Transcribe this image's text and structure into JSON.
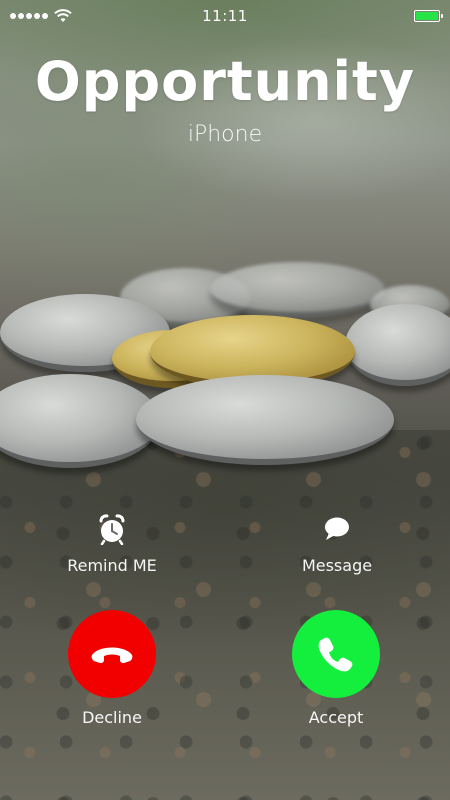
{
  "status_bar": {
    "time": "11:11",
    "signal_icon": "signal-dots-icon",
    "wifi_icon": "wifi-icon",
    "battery_icon": "battery-icon",
    "battery_color": "#27e34a"
  },
  "call": {
    "caller_name": "Opportunity",
    "caller_subtitle": "iPhone"
  },
  "actions": {
    "remind": {
      "label": "Remind ME",
      "icon": "alarm-clock-icon"
    },
    "message": {
      "label": "Message",
      "icon": "speech-bubble-icon"
    },
    "decline": {
      "label": "Decline",
      "icon": "phone-hangup-icon",
      "color": "#f20000"
    },
    "accept": {
      "label": "Accept",
      "icon": "phone-icon",
      "color": "#14ef3e"
    }
  }
}
